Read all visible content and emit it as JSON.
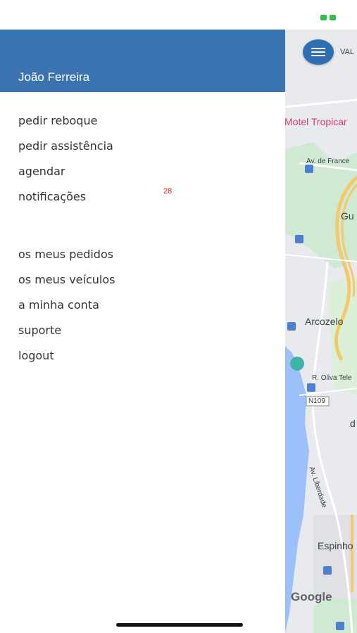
{
  "status": {
    "battery_icon": "battery-icon",
    "battery_color": "#2fbe48"
  },
  "drawer": {
    "header_color": "#3b73b1",
    "user_name": "João Ferreira",
    "items_primary": [
      {
        "label": "pedir reboque"
      },
      {
        "label": "pedir assistência"
      },
      {
        "label": "agendar"
      },
      {
        "label": "notificações",
        "badge": "28"
      }
    ],
    "items_secondary": [
      {
        "label": "os meus pedidos"
      },
      {
        "label": "os meus veículos"
      },
      {
        "label": "a minha conta"
      },
      {
        "label": "suporte"
      },
      {
        "label": "logout"
      }
    ]
  },
  "map": {
    "menu_icon": "hamburger-icon",
    "labels": {
      "val": "VAL",
      "motel": "Motel Tropicar",
      "av_france": "Av. de France",
      "gu": "Gu",
      "arcozelo": "Arcozelo",
      "oliva": "R. Oliva Tele",
      "n109": "N109",
      "d": "d",
      "liberdade": "Av. Liberdade",
      "espinho": "Espinho",
      "google": "Google"
    }
  }
}
